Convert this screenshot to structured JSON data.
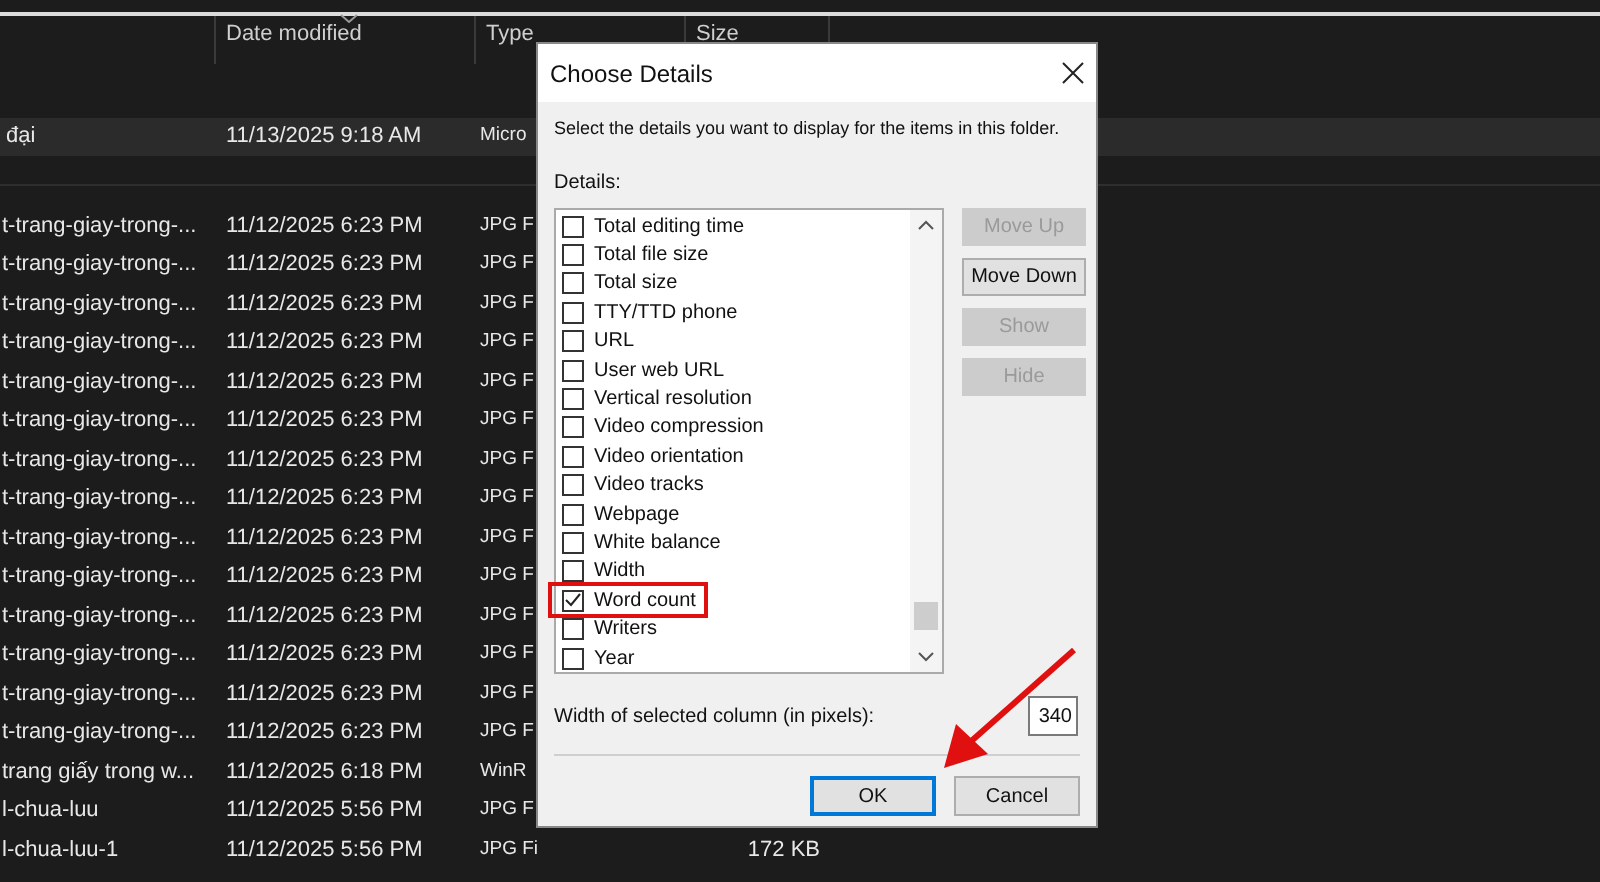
{
  "explorer": {
    "columns": [
      {
        "label": "Date modified",
        "sorted": true
      },
      {
        "label": "Type",
        "sorted": false
      },
      {
        "label": "Size",
        "sorted": false
      }
    ],
    "group_row": {
      "name": "đại",
      "date": "11/13/2025 9:18 AM",
      "type": "Micro"
    },
    "rows": [
      {
        "name": "t-trang-giay-trong-...",
        "date": "11/12/2025 6:23 PM",
        "type": "JPG F"
      },
      {
        "name": "t-trang-giay-trong-...",
        "date": "11/12/2025 6:23 PM",
        "type": "JPG F"
      },
      {
        "name": "t-trang-giay-trong-...",
        "date": "11/12/2025 6:23 PM",
        "type": "JPG F"
      },
      {
        "name": "t-trang-giay-trong-...",
        "date": "11/12/2025 6:23 PM",
        "type": "JPG F"
      },
      {
        "name": "t-trang-giay-trong-...",
        "date": "11/12/2025 6:23 PM",
        "type": "JPG F"
      },
      {
        "name": "t-trang-giay-trong-...",
        "date": "11/12/2025 6:23 PM",
        "type": "JPG F"
      },
      {
        "name": "t-trang-giay-trong-...",
        "date": "11/12/2025 6:23 PM",
        "type": "JPG F"
      },
      {
        "name": "t-trang-giay-trong-...",
        "date": "11/12/2025 6:23 PM",
        "type": "JPG F"
      },
      {
        "name": "t-trang-giay-trong-...",
        "date": "11/12/2025 6:23 PM",
        "type": "JPG F"
      },
      {
        "name": "t-trang-giay-trong-...",
        "date": "11/12/2025 6:23 PM",
        "type": "JPG F"
      },
      {
        "name": "t-trang-giay-trong-...",
        "date": "11/12/2025 6:23 PM",
        "type": "JPG F"
      },
      {
        "name": "t-trang-giay-trong-...",
        "date": "11/12/2025 6:23 PM",
        "type": "JPG F"
      },
      {
        "name": "t-trang-giay-trong-...",
        "date": "11/12/2025 6:23 PM",
        "type": "JPG F"
      },
      {
        "name": "t-trang-giay-trong-...",
        "date": "11/12/2025 6:23 PM",
        "type": "JPG F"
      },
      {
        "name": "trang giấy trong w...",
        "date": "11/12/2025 6:18 PM",
        "type": "WinR"
      },
      {
        "name": "l-chua-luu",
        "date": "11/12/2025 5:56 PM",
        "type": "JPG F"
      },
      {
        "name": "l-chua-luu-1",
        "date": "11/12/2025 5:56 PM",
        "type": "JPG Fi",
        "size": "172 KB"
      }
    ]
  },
  "dialog": {
    "title": "Choose Details",
    "instruction": "Select the details you want to display for the items in this folder.",
    "details_label": "Details:",
    "items": [
      {
        "label": "Total editing time",
        "checked": false,
        "marked": false
      },
      {
        "label": "Total file size",
        "checked": false,
        "marked": false
      },
      {
        "label": "Total size",
        "checked": false,
        "marked": false
      },
      {
        "label": "TTY/TTD phone",
        "checked": false,
        "marked": false
      },
      {
        "label": "URL",
        "checked": false,
        "marked": false
      },
      {
        "label": "User web URL",
        "checked": false,
        "marked": false
      },
      {
        "label": "Vertical resolution",
        "checked": false,
        "marked": false
      },
      {
        "label": "Video compression",
        "checked": false,
        "marked": false
      },
      {
        "label": "Video orientation",
        "checked": false,
        "marked": false
      },
      {
        "label": "Video tracks",
        "checked": false,
        "marked": false
      },
      {
        "label": "Webpage",
        "checked": false,
        "marked": false
      },
      {
        "label": "White balance",
        "checked": false,
        "marked": false
      },
      {
        "label": "Width",
        "checked": false,
        "marked": false
      },
      {
        "label": "Word count",
        "checked": true,
        "marked": true
      },
      {
        "label": "Writers",
        "checked": false,
        "marked": false
      },
      {
        "label": "Year",
        "checked": false,
        "marked": false
      }
    ],
    "side_buttons": [
      {
        "label": "Move Up",
        "disabled": true
      },
      {
        "label": "Move Down",
        "disabled": false
      },
      {
        "label": "Show",
        "disabled": true
      },
      {
        "label": "Hide",
        "disabled": true
      }
    ],
    "width_label": "Width of selected column (in pixels):",
    "width_value": "340",
    "footer_buttons": [
      {
        "label": "OK",
        "default": true
      },
      {
        "label": "Cancel",
        "default": false
      }
    ]
  }
}
